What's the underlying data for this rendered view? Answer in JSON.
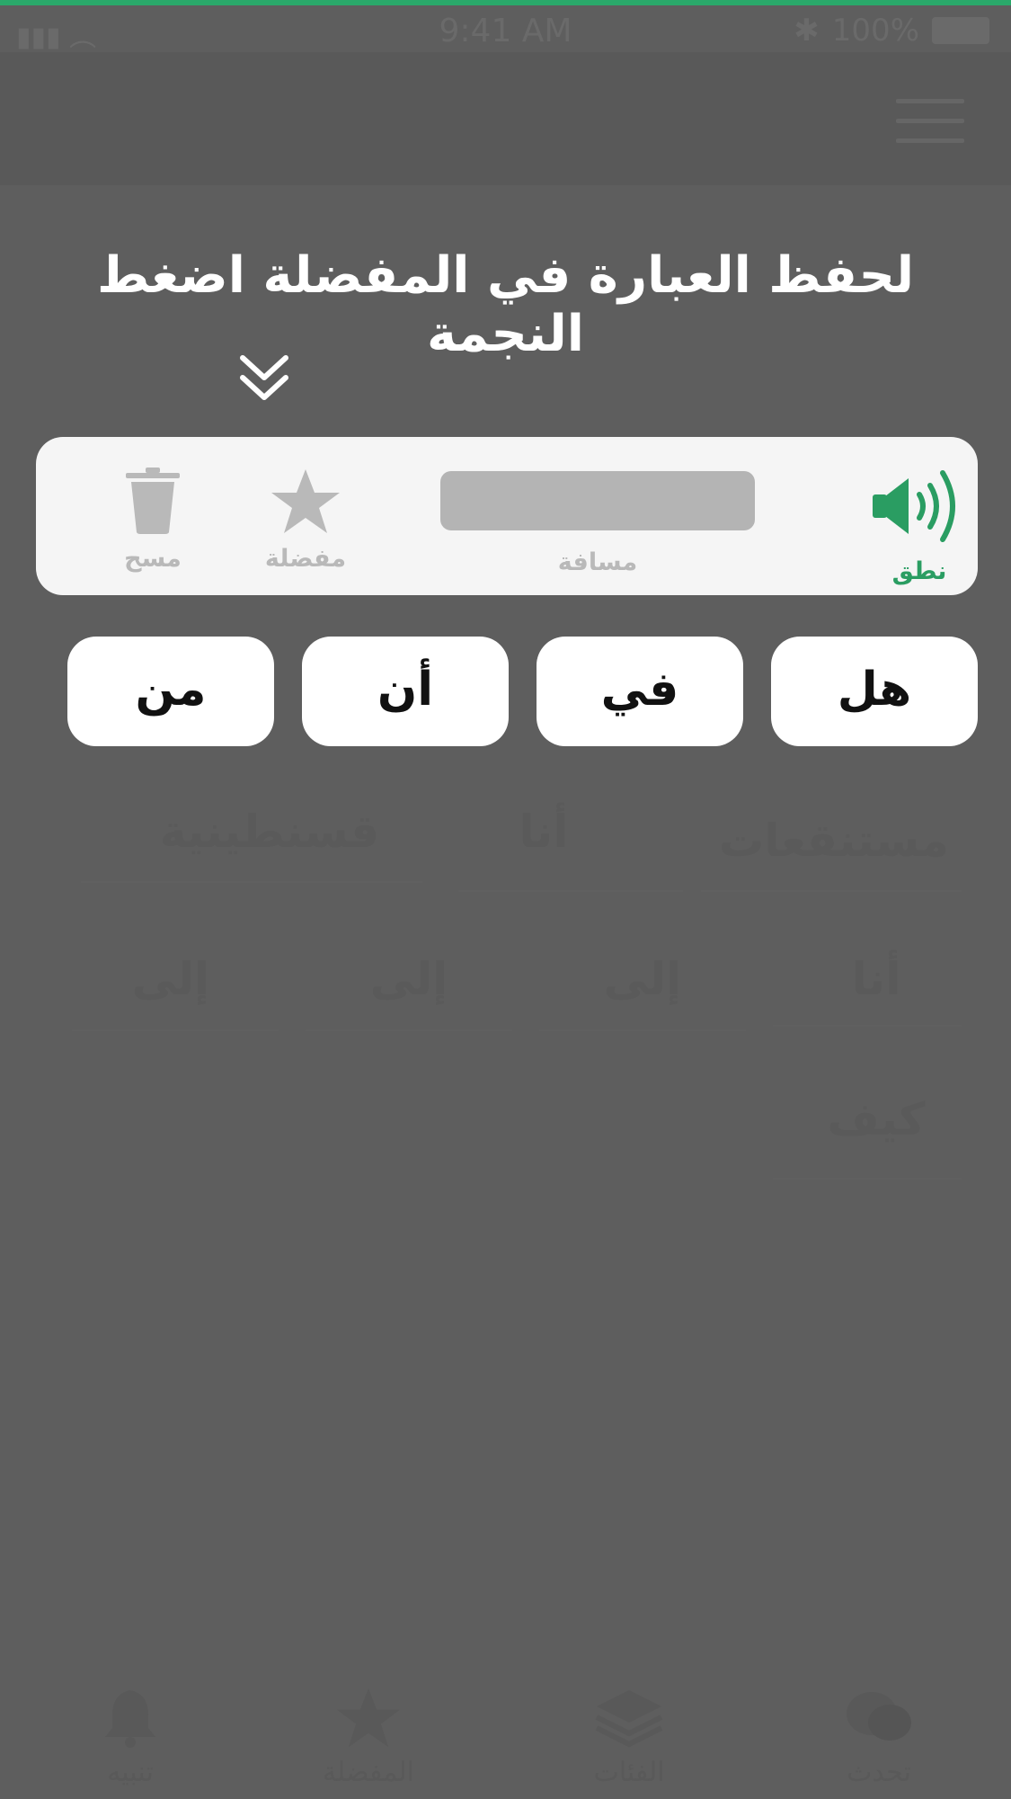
{
  "status_bar": {
    "time": "9:41 AM",
    "battery": "100%"
  },
  "hint": {
    "text": "لحفظ العبارة في المفضلة اضغط النجمة"
  },
  "phrase_card": {
    "speak_label": "نطق",
    "space_label": "مسافة",
    "favorite_label": "مفضلة",
    "delete_label": "مسح"
  },
  "suggestions": [
    {
      "label": "هل"
    },
    {
      "label": "في"
    },
    {
      "label": "أن"
    },
    {
      "label": "من"
    }
  ],
  "background_words": {
    "row1": [
      "مستنقعات",
      "أنا",
      "قسنطينية"
    ],
    "row2": [
      "أنا",
      "إلى",
      "إلى",
      "إلى"
    ],
    "row3": [
      "كيف"
    ]
  },
  "tabs": [
    {
      "label": "تحدث",
      "icon": "chat-bubbles-icon"
    },
    {
      "label": "الفئات",
      "icon": "layers-icon"
    },
    {
      "label": "المفضلة",
      "icon": "star-icon"
    },
    {
      "label": "تنبيه",
      "icon": "bell-icon"
    }
  ],
  "colors": {
    "accent": "#2aa86a",
    "speak_green": "#2a9d62",
    "overlay": "#5e5e5e"
  }
}
